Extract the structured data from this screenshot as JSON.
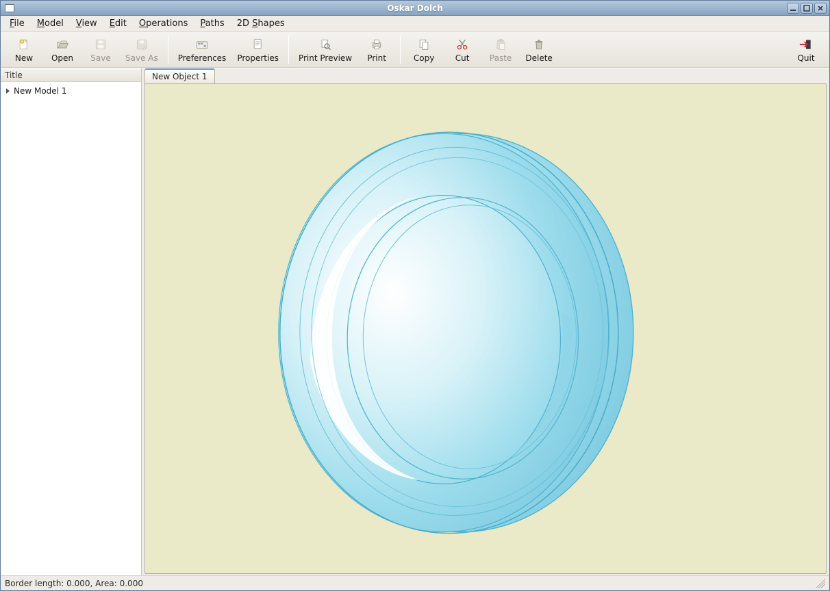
{
  "window": {
    "title": "Oskar Dolch"
  },
  "menu": {
    "file": "File",
    "model": "Model",
    "view": "View",
    "edit": "Edit",
    "operations": "Operations",
    "paths": "Paths",
    "shapes": "2D Shapes"
  },
  "toolbar": {
    "new": "New",
    "open": "Open",
    "save": "Save",
    "save_as": "Save As",
    "preferences": "Preferences",
    "properties": "Properties",
    "print_preview": "Print Preview",
    "print": "Print",
    "copy": "Copy",
    "cut": "Cut",
    "paste": "Paste",
    "delete": "Delete",
    "quit": "Quit"
  },
  "sidebar": {
    "header": "Title",
    "items": [
      {
        "label": "New Model 1"
      }
    ]
  },
  "tabs": [
    {
      "label": "New Object 1"
    }
  ],
  "status": {
    "text": "Border length: 0.000, Area: 0.000"
  },
  "colors": {
    "canvas_bg": "#eae9c8",
    "ring_stroke": "#4fb2cf",
    "ring_fill_light": "#c9ecf4",
    "ring_fill_mid": "#9cdcec",
    "ring_highlight": "#ffffff"
  }
}
